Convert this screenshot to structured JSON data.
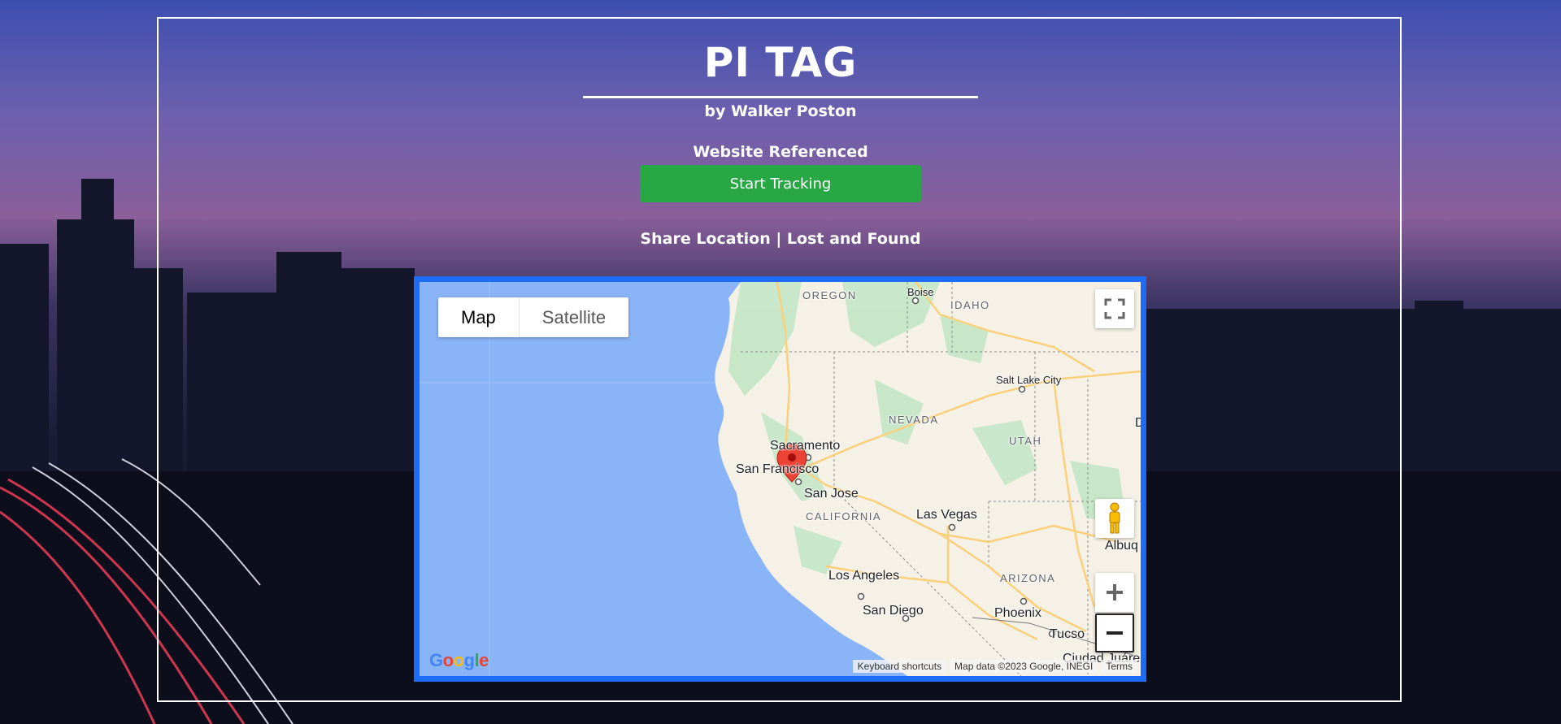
{
  "header": {
    "title": "PI TAG",
    "author": "by Walker Poston",
    "reference": "Website Referenced",
    "start_button": "Start Tracking",
    "share_link": "Share Location",
    "separator": " | ",
    "lost_link": "Lost and Found"
  },
  "map": {
    "type_controls": {
      "map": "Map",
      "satellite": "Satellite"
    },
    "labels": {
      "oregon": "OREGON",
      "idaho": "IDAHO",
      "nevada": "NEVADA",
      "utah": "UTAH",
      "california": "CALIFORNIA",
      "arizona": "ARIZONA",
      "boise": "Boise",
      "salt_lake": "Salt Lake City",
      "sacramento": "Sacramento",
      "san_francisco": "San Francisco",
      "san_jose": "San Jose",
      "las_vegas": "Las Vegas",
      "los_angeles": "Los Angeles",
      "san_diego": "San Diego",
      "phoenix": "Phoenix",
      "tucson": "Tucso",
      "albuquerque": "Albuq",
      "ciudad_juarez": "Ciudad Juáre",
      "denver_edge": "D"
    },
    "footer": {
      "shortcuts": "Keyboard shortcuts",
      "data": "Map data ©2023 Google, INEGI",
      "terms": "Terms"
    },
    "logo": "Google",
    "colors": {
      "water": "#8ab4f8",
      "land": "#f5f1e6",
      "green": "#c4e6c6",
      "road": "#fbd07a",
      "border": "#1e6cf5",
      "marker": "#ea4335"
    }
  }
}
